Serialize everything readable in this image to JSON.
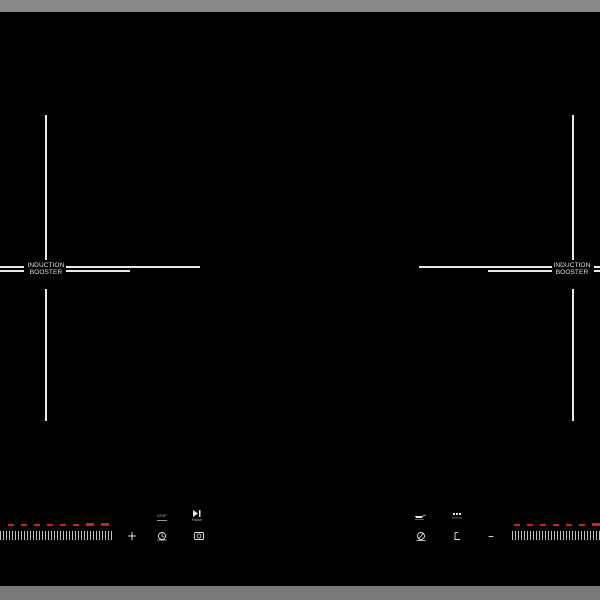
{
  "zones": {
    "left": {
      "label_line1": "INDUCTION",
      "label_line2": "BOOSTER"
    },
    "right": {
      "label_line1": "INDUCTION",
      "label_line2": "BOOSTER"
    }
  },
  "controls": {
    "left": {
      "plus_symbol": "+",
      "stop_label": "STOP",
      "pause_label": "Pause",
      "power_level_segments": 8,
      "power_level_lit": 8
    },
    "right": {
      "minus_symbol": "–",
      "power_level_segments": 8,
      "power_level_lit": 8
    }
  },
  "colors": {
    "glass": "#000000",
    "frame": "#6f6f6f",
    "markings": "#e8e8e8",
    "indicator": "#e11a1a"
  },
  "icons": {
    "play_pause": "play-pause-icon",
    "stop_go": "stop-go-icon",
    "timer": "timer-icon",
    "lock": "child-lock-icon",
    "pan": "pan-icon",
    "keep_warm": "keep-warm-icon",
    "bridge": "bridge-icon"
  }
}
